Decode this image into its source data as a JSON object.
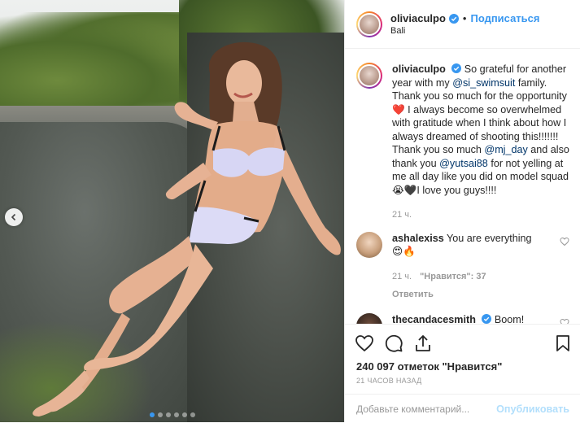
{
  "post": {
    "username": "oliviaculpo",
    "follow_label": "Подписаться",
    "separator": "•",
    "location": "Bali"
  },
  "caption": {
    "username": "oliviaculpo",
    "text_1": " So grateful for another year with my ",
    "mention_1": "@si_swimsuit",
    "text_2": " family. Thank you so much for the opportunity",
    "emoji_heart": "❤️",
    "text_3": " I always become so overwhelmed with gratitude when I think about how I always dreamed of shooting this!!!!!!! Thank you so much ",
    "mention_2": "@mj_day",
    "text_4": " and also thank you ",
    "mention_3": "@yutsai88",
    "text_5": " for not yelling at me all day like you did on model squad ",
    "emoji_end": "😭🖤",
    "text_6": "I love you guys!!!!",
    "time": "21 ч."
  },
  "comments": [
    {
      "username": "ashalexiss",
      "text": " You are everything",
      "emoji": "😍🔥",
      "time": "21 ч.",
      "likes": "\"Нравится\": 37",
      "reply": "Ответить"
    },
    {
      "username": "thecandacesmith",
      "text": " Boom!"
    }
  ],
  "actions": {
    "likes": "240 097 отметок \"Нравится\"",
    "timestamp": "21 ЧАСОВ НАЗАД",
    "comment_placeholder": "Добавьте комментарий...",
    "publish_label": "Опубликовать"
  },
  "carousel": {
    "slides": 6,
    "active_slide": 1
  },
  "colors": {
    "accent": "#3897f0",
    "mention": "#003569",
    "muted": "#999999",
    "publish_disabled": "#b2dffc"
  }
}
